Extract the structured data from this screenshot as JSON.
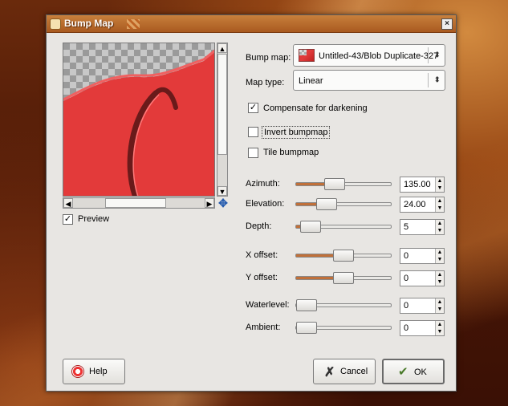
{
  "window": {
    "title": "Bump Map",
    "close_glyph": "×"
  },
  "preview": {
    "checkbox_label": "Preview",
    "checked": true,
    "colors": {
      "bump": "#e33a3a",
      "checker_light": "#c8c8c8",
      "checker_dark": "#9a9a9a"
    }
  },
  "settings": {
    "bump_map": {
      "label": "Bump map:",
      "value": "Untitled-43/Blob Duplicate-327"
    },
    "map_type": {
      "label": "Map type:",
      "value": "Linear"
    },
    "compensate": {
      "label": "Compensate for darkening",
      "checked": true
    },
    "invert": {
      "label": "Invert bumpmap",
      "checked": false
    },
    "tile": {
      "label": "Tile bumpmap",
      "checked": false
    }
  },
  "sliders": [
    {
      "label": "Azimuth:",
      "value": "135.00",
      "fraction": 0.375
    },
    {
      "label": "Elevation:",
      "value": "24.00",
      "fraction": 0.27
    },
    {
      "label": "Depth:",
      "value": "5",
      "fraction": 0.05
    },
    {
      "label": "X offset:",
      "value": "0",
      "fraction": 0.5
    },
    {
      "label": "Y offset:",
      "value": "0",
      "fraction": 0.5
    },
    {
      "label": "Waterlevel:",
      "value": "0",
      "fraction": 0.0
    },
    {
      "label": "Ambient:",
      "value": "0",
      "fraction": 0.0
    }
  ],
  "buttons": {
    "help": "Help",
    "cancel": "Cancel",
    "ok": "OK"
  },
  "accent_color": "#c0703a"
}
